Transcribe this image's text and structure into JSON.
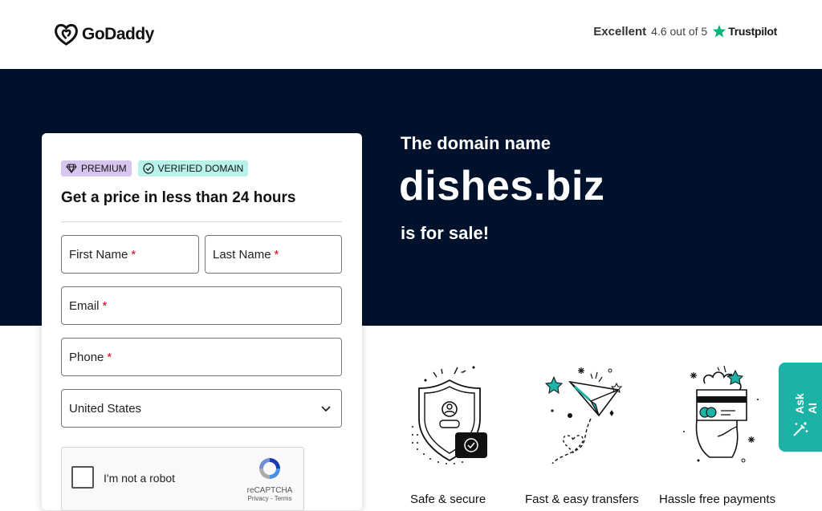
{
  "header": {
    "logo_text": "GoDaddy",
    "trust": {
      "rating_word": "Excellent",
      "score": "4.6 out of 5",
      "brand": "Trustpilot"
    }
  },
  "hero": {
    "pre": "The domain name",
    "domain": "dishes.biz",
    "post": "is for sale!"
  },
  "form": {
    "badges": [
      "PREMIUM",
      "VERIFIED DOMAIN"
    ],
    "title": "Get a price in less than 24 hours",
    "first_name": "First Name",
    "last_name": "Last Name",
    "email": "Email",
    "phone": "Phone",
    "required_mark": "*",
    "country": "United States",
    "captcha": {
      "label": "I'm not a robot",
      "brand": "reCAPTCHA",
      "links": "Privacy - Terms"
    }
  },
  "features": [
    {
      "label": "Safe & secure",
      "icon": "shield-lock-icon"
    },
    {
      "label": "Fast & easy transfers",
      "icon": "paper-plane-icon"
    },
    {
      "label": "Hassle free payments",
      "icon": "card-in-hand-icon"
    }
  ],
  "ask_ai": {
    "label": "Ask AI",
    "icon": "magic-wand-icon"
  },
  "colors": {
    "hero_bg": "#00112c",
    "premium_badge": "#d8c5ef",
    "verified_badge": "#b9f2ea",
    "ask_ai_bg": "#1bb3a6",
    "trustpilot_star": "#00b67a",
    "required": "#d6001c"
  }
}
